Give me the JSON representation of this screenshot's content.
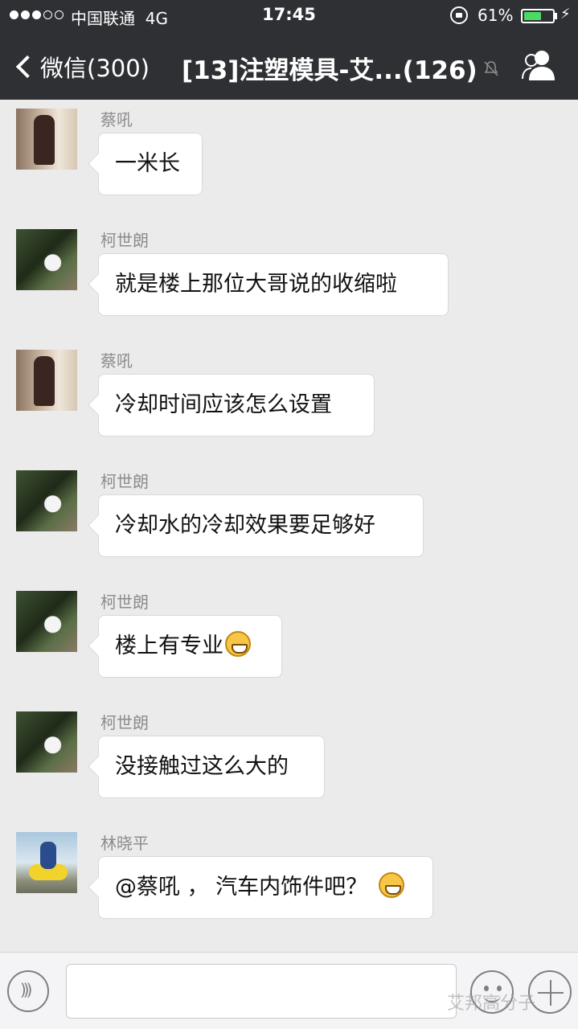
{
  "status_bar": {
    "carrier": "中国联通",
    "network": "4G",
    "time": "17:45",
    "battery_percent_text": "61%",
    "battery_level": 0.61,
    "signal_bars_filled": 3,
    "signal_bars_total": 5
  },
  "nav": {
    "back_label": "微信(300)",
    "title": "[13]注塑模具-艾...(126)"
  },
  "messages": [
    {
      "sender": "蔡吼",
      "text": "一米长",
      "avatar": "cai",
      "emoji": false
    },
    {
      "sender": "柯世朗",
      "text": "就是楼上那位大哥说的收缩啦",
      "avatar": "ke",
      "emoji": false
    },
    {
      "sender": "蔡吼",
      "text": "冷却时间应该怎么设置",
      "avatar": "cai",
      "emoji": false
    },
    {
      "sender": "柯世朗",
      "text": "冷却水的冷却效果要足够好",
      "avatar": "ke",
      "emoji": false
    },
    {
      "sender": "柯世朗",
      "text": "楼上有专业",
      "avatar": "ke",
      "emoji": true
    },
    {
      "sender": "柯世朗",
      "text": "没接触过这么大的",
      "avatar": "ke",
      "emoji": false
    },
    {
      "sender": "林晓平",
      "text": "@蔡吼 ， 汽车内饰件吧？",
      "avatar": "lin",
      "emoji": true
    }
  ],
  "partial_sender": "蔡吼",
  "watermark": "艾邦高分子",
  "colors": {
    "header_bg": "#2e3034",
    "chat_bg": "#ebebeb",
    "battery_green": "#4cd964"
  },
  "icons": [
    "back-chevron-icon",
    "mute-icon",
    "contacts-icon",
    "voice-icon",
    "emoji-icon",
    "plus-icon"
  ]
}
